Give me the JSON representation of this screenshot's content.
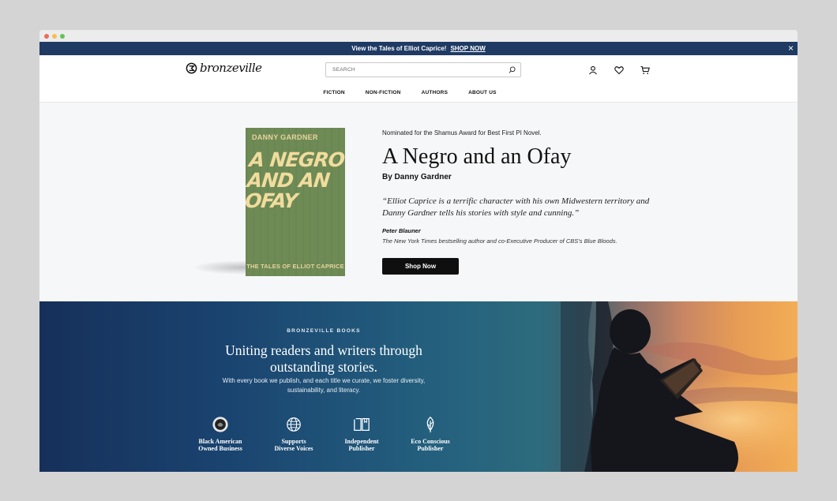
{
  "announcement": {
    "text": "View the Tales of Elliot Caprice!",
    "link": "SHOP NOW",
    "close": "×"
  },
  "header": {
    "logo_text": "bronzeville",
    "search_placeholder": "SEARCH",
    "icons": [
      "account-icon",
      "wishlist-heart-icon",
      "cart-icon"
    ],
    "nav": [
      "FICTION",
      "NON-FICTION",
      "AUTHORS",
      "ABOUT US"
    ]
  },
  "hero": {
    "cover": {
      "author": "DANNY GARDNER",
      "title": "A NEGRO AND AN OFAY",
      "series": "THE TALES OF ELLIOT CAPRICE"
    },
    "nominated": "Nominated for the Shamus Award for Best First PI Novel.",
    "title": "A Negro and an Ofay",
    "byline": "By Danny Gardner",
    "quote": "“Elliot Caprice is a terrific character with his own Midwestern territory and Danny Gardner tells his stories with style and cunning.”",
    "quote_name": "Peter Blauner",
    "quote_role": "The New York Times bestselling author and co-Executive Producer of CBS’s Blue Bloods.",
    "cta": "Shop Now"
  },
  "band": {
    "kicker": "BRONZEVILLE BOOKS",
    "heading": "Uniting readers and writers through outstanding stories.",
    "sub": "With every book we publish, and each title we curate, we foster diversity, sustainability, and literacy.",
    "features": [
      {
        "icon": "black-owned-badge-icon",
        "line1": "Black American",
        "line2": "Owned Business"
      },
      {
        "icon": "globe-people-icon",
        "line1": "Supports",
        "line2": "Diverse Voices"
      },
      {
        "icon": "open-book-icon",
        "line1": "Independent",
        "line2": "Publisher"
      },
      {
        "icon": "leaf-icon",
        "line1": "Eco Conscious",
        "line2": "Publisher"
      }
    ]
  },
  "colors": {
    "announcement_bg": "#1f3a63",
    "cover_green": "#6e8b56",
    "cta_bg": "#0f0f0f"
  }
}
